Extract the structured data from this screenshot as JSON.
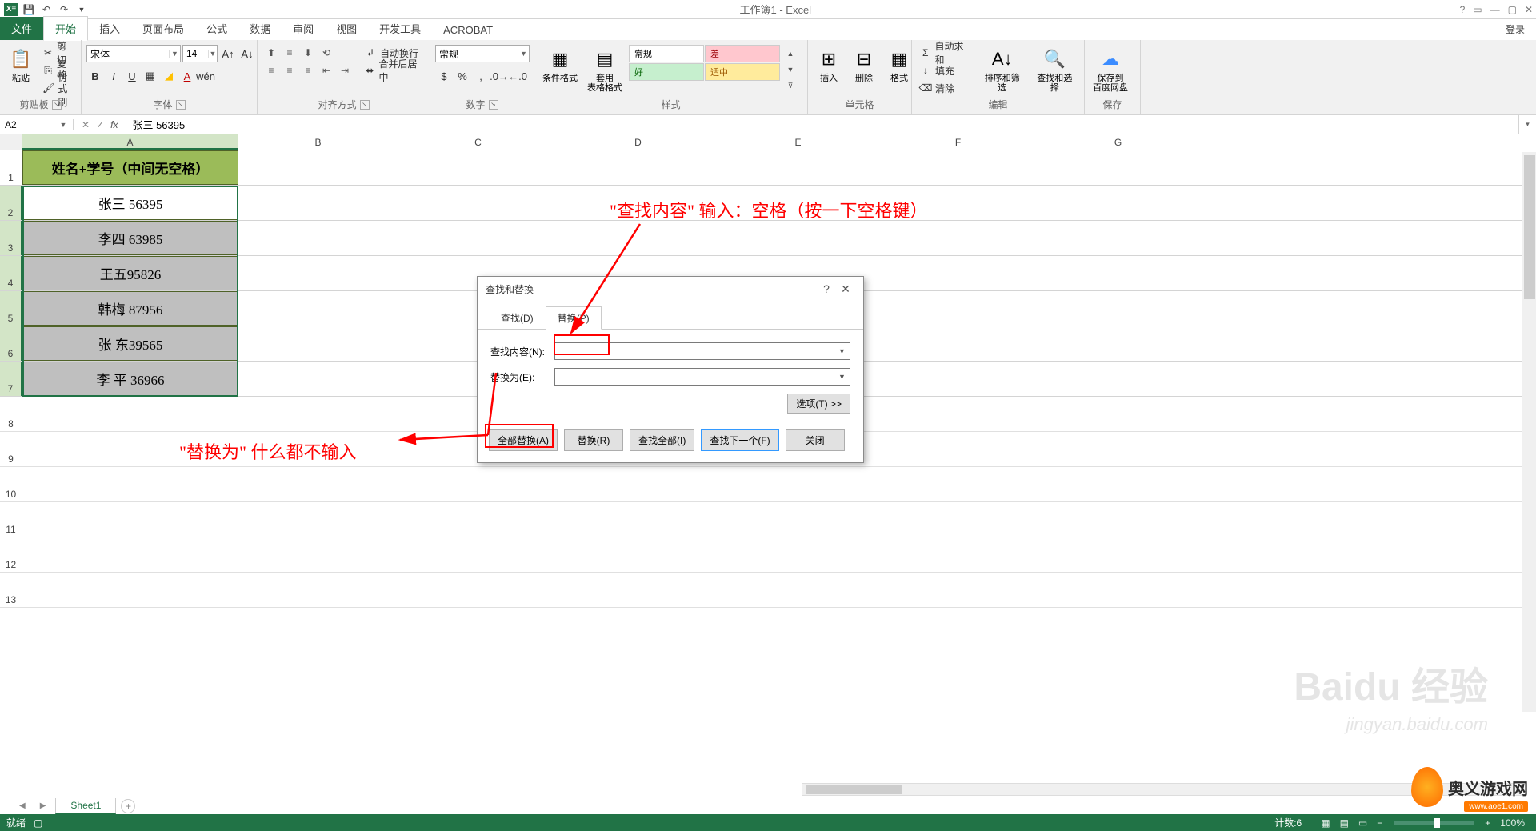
{
  "qat": {
    "title": "工作簿1 - Excel"
  },
  "tabs": {
    "file": "文件",
    "home": "开始",
    "insert": "插入",
    "layout": "页面布局",
    "formulas": "公式",
    "data": "数据",
    "review": "审阅",
    "view": "视图",
    "dev": "开发工具",
    "acrobat": "ACROBAT",
    "login": "登录"
  },
  "ribbon": {
    "clipboard": {
      "paste": "粘贴",
      "cut": "剪切",
      "copy": "复制",
      "painter": "格式刷",
      "label": "剪贴板"
    },
    "font": {
      "name": "宋体",
      "size": "14",
      "label": "字体"
    },
    "align": {
      "wrap": "自动换行",
      "merge": "合并后居中",
      "label": "对齐方式"
    },
    "number": {
      "format": "常规",
      "label": "数字"
    },
    "styles": {
      "cond": "条件格式",
      "table": "套用\n表格格式",
      "normal": "常规",
      "bad": "差",
      "good": "好",
      "neutral": "适中",
      "label": "样式"
    },
    "cells": {
      "insert": "插入",
      "delete": "删除",
      "format": "格式",
      "label": "单元格"
    },
    "editing": {
      "sum": "自动求和",
      "fill": "填充",
      "clear": "清除",
      "sort": "排序和筛选",
      "find": "查找和选择",
      "label": "编辑"
    },
    "save": {
      "label": "保存",
      "btn": "保存到\n百度网盘"
    }
  },
  "namebox": "A2",
  "formula": "张三 56395",
  "columns": [
    "A",
    "B",
    "C",
    "D",
    "E",
    "F",
    "G"
  ],
  "data": {
    "header": "姓名+学号（中间无空格）",
    "rows": [
      "张三 56395",
      "李四 63985",
      "王五95826",
      "韩梅 87956",
      "张 东39565",
      "李 平 36966"
    ]
  },
  "dialog": {
    "title": "查找和替换",
    "tab_find": "查找(D)",
    "tab_replace": "替换(P)",
    "lbl_find": "查找内容(N):",
    "lbl_replace": "替换为(E):",
    "val_find": "",
    "val_replace": "",
    "options": "选项(T) >>",
    "btn_replace_all": "全部替换(A)",
    "btn_replace": "替换(R)",
    "btn_find_all": "查找全部(I)",
    "btn_find_next": "查找下一个(F)",
    "btn_close": "关闭"
  },
  "annotations": {
    "top": "\"查找内容\" 输入：空格（按一下空格键）",
    "bottom": "\"替换为\" 什么都不输入"
  },
  "sheet_tab": "Sheet1",
  "status": {
    "ready": "就绪",
    "count_label": "计数:",
    "count": "6",
    "zoom": "100%"
  },
  "watermark": {
    "logo": "Baidu 经验",
    "url": "jingyan.baidu.com"
  },
  "brand": {
    "name": "奥义游戏网",
    "url": "www.aoe1.com"
  }
}
